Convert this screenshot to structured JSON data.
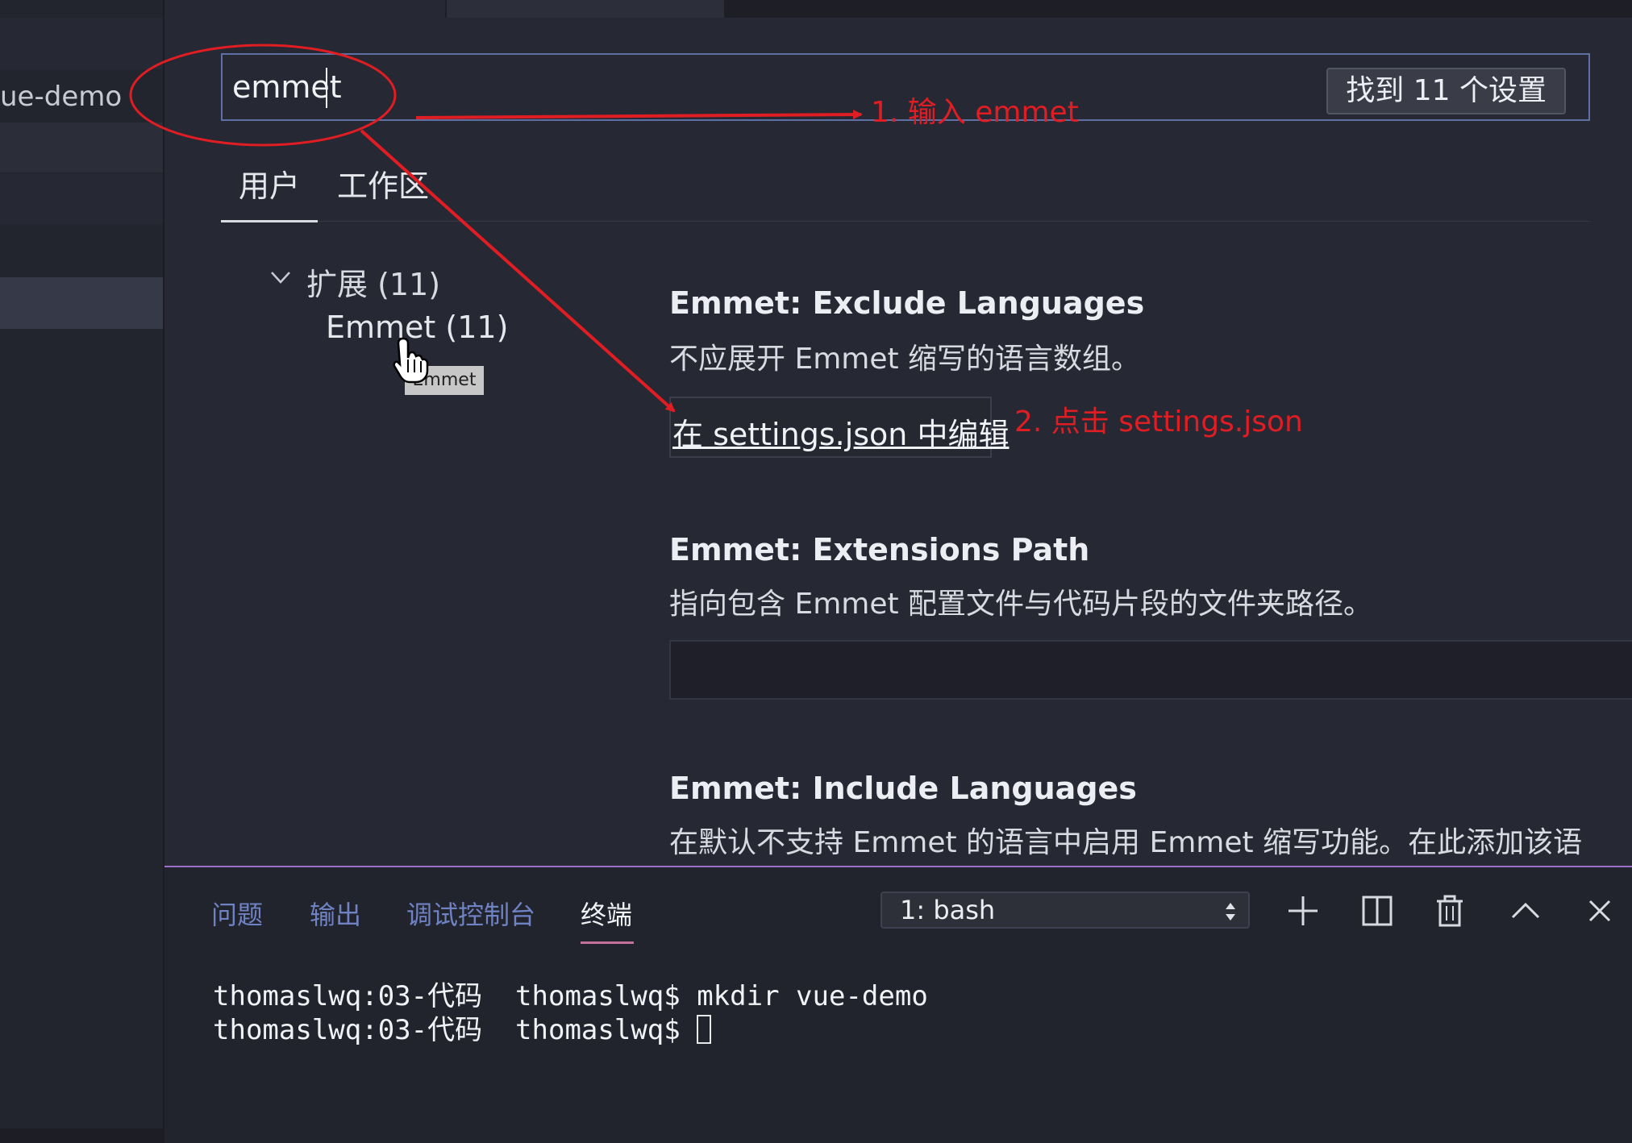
{
  "sidebar": {
    "project_label": "ue-demo"
  },
  "search": {
    "query": "emmet",
    "result_count": "找到 11 个设置"
  },
  "scope_tabs": [
    "用户",
    "工作区"
  ],
  "toc": {
    "group": "扩展 (11)",
    "item": "Emmet (11)",
    "tooltip": "Emmet"
  },
  "settings": [
    {
      "title": "Emmet: Exclude Languages",
      "description": "不应展开 Emmet 缩写的语言数组。",
      "edit_link": "在 settings.json 中编辑"
    },
    {
      "title": "Emmet: Extensions Path",
      "description": "指向包含 Emmet 配置文件与代码片段的文件夹路径。",
      "value": ""
    },
    {
      "title": "Emmet: Include Languages",
      "description": "在默认不支持 Emmet 的语言中启用 Emmet 缩写功能。在此添加该语"
    }
  ],
  "annotations": {
    "step1": "1. 输入 emmet",
    "step2": "2. 点击 settings.json",
    "color": "#e11d24"
  },
  "panel": {
    "tabs": [
      "问题",
      "输出",
      "调试控制台",
      "终端"
    ],
    "active_tab": "终端",
    "terminal_select": "1: bash",
    "terminal_lines": [
      "thomaslwq:03-代码  thomaslwq$ mkdir vue-demo",
      "thomaslwq:03-代码  thomaslwq$ "
    ],
    "accent_color": "#9c6fc9"
  }
}
